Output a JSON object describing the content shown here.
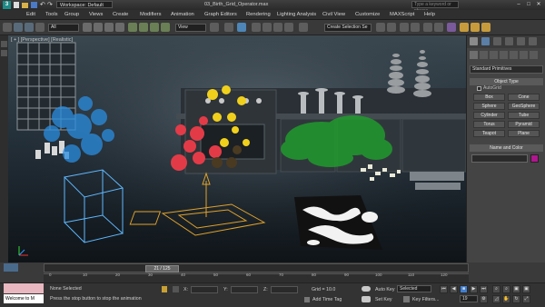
{
  "app": {
    "logo": "3",
    "workspace": "Workspace: Default",
    "file_title": "03_Birth_Grid_Operator.max",
    "search_placeholder": "Type a keyword or phrase"
  },
  "menu": [
    "Edit",
    "Tools",
    "Group",
    "Views",
    "Create",
    "Modifiers",
    "Animation",
    "Graph Editors",
    "Rendering",
    "Lighting Analysis",
    "Civil View",
    "Customize",
    "MAXScript",
    "Help"
  ],
  "toolbar": {
    "selection_filter": "All",
    "ref_coord": "View",
    "named_selection": "Create Selection Se"
  },
  "viewport": {
    "label": "[ + ] [Perspective] [Realistic]"
  },
  "command_panel": {
    "category": "Standard Primitives",
    "object_type_header": "Object Type",
    "autogrid": "AutoGrid",
    "buttons": [
      "Box",
      "Cone",
      "Sphere",
      "GeoSphere",
      "Cylinder",
      "Tube",
      "Torus",
      "Pyramid",
      "Teapot",
      "Plane"
    ],
    "name_color_header": "Name and Color",
    "swatch_color": "#b0168f"
  },
  "timeline": {
    "frame_indicator": "21 / 125",
    "ticks": [
      "0",
      "10",
      "20",
      "30",
      "40",
      "50",
      "60",
      "70",
      "80",
      "90",
      "100",
      "110",
      "120"
    ]
  },
  "status": {
    "listener": "Welcome to M",
    "selection": "None Selected",
    "prompt": "Press the stop button to stop the animation",
    "x_label": "X:",
    "y_label": "Y:",
    "z_label": "Z:",
    "grid": "Grid = 10.0",
    "add_time_tag": "Add Time Tag",
    "auto_key": "Auto Key",
    "selected_combo": "Selected",
    "set_key": "Set Key",
    "key_filters": "Key Filters...",
    "current_frame": "19"
  }
}
